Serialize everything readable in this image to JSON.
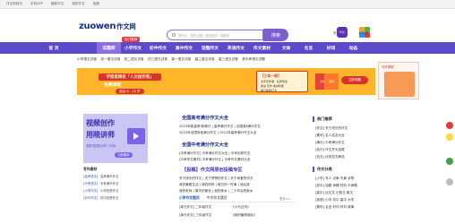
{
  "topbar": [
    "作文网首页",
    "手机APP",
    "最新作文",
    "我的作文",
    "投稿"
  ],
  "header": {
    "logo_word": "zuowen",
    "logo_cn": "作文网",
    "search_placeholder": "搜作文 / 搜作文题 / 搜关键词 / 搜素材",
    "search_button": "搜索",
    "app1_label": "官方APP",
    "app1_icon_text": "作文",
    "app2_label": "手机版",
    "hot_badge": "热门推荐"
  },
  "nav": [
    "首 页",
    "试题库",
    "小学作文",
    "初中作文",
    "高中作文",
    "话题作文",
    "英语作文",
    "作文素材",
    "文体",
    "名言",
    "好词",
    "动态"
  ],
  "nav_active": 1,
  "subnav": [
    "小学语文试卷",
    "初一语文试卷",
    "初二语文试卷",
    "初三语文试卷",
    "高一语文试卷",
    "高二语文试卷",
    "高三语文试卷",
    "其中考语文试题"
  ],
  "banner": {
    "headline": "学而思网校「人文创作课」",
    "sub": "免费领取",
    "age": "适合 6 - 13 岁",
    "mid_title": "【三年一轮】",
    "mid_lines": [
      "全年写作课 · 名师带读",
      "阅读·写作·素材积累",
      "每日练笔打卡"
    ],
    "book1": "文学",
    "book2": "写作",
    "button": "立即领取",
    "side_label": "写作课程"
  },
  "promo": {
    "line1": "视频创作",
    "line2": "用晓讲师",
    "tagline": "录屏/剪辑/分享一步搞",
    "cta": "立即使用"
  },
  "left_section": {
    "title": "写作素材",
    "rows": [
      [
        "[高考语文]",
        "高考满分作文"
      ],
      [
        "[中考语文]",
        "中考满分作文"
      ],
      [
        "[小学作文]",
        "小学优秀作文"
      ],
      [
        "[初中作文]",
        "初中优秀作文"
      ]
    ]
  },
  "center": {
    "title1": "全国高考满分作文大全",
    "lines1": [
      "2023年新高考Ⅰ卷满分 | 高考满分作文 | 全国卷Ⅱ满分作文",
      "2023年全国甲卷满分作文 | 2022年高考满分作文大全"
    ],
    "title2": "全国中考满分作文大全",
    "lines2": [
      "[中考满分作文] 中考满分作文大全 | 中考优秀作文",
      "[中考作文素材] 中考满分作文 | 中考作文素材大全"
    ],
    "title3": "【投稿】作文网原创投稿专区",
    "lines3": [
      "关于快乐的作文 | 关于梦想的作文 | 关于母爱的作文",
      "我的暑假生活 | 我的妈妈 | 难忘的一件事 | 读后感",
      "我的老师 | 春天的景色 | 我的家乡 | 二十年后的家乡"
    ],
    "tabs": [
      "小学作文题目",
      "中学作文题目",
      "高中作文题目"
    ],
    "more": "更多>>",
    "rows": [
      [
        "[单元作文] 二年级作文",
        "《小马过河》"
      ],
      [
        "[单元作文] 三年级作文",
        "《我的植物朋友》"
      ]
    ]
  },
  "right": {
    "title": "热门推荐",
    "items": [
      "[作文] 关于成长的作文",
      "[素材] 名人名言大全",
      "[满分] 中考满分作文",
      "[技巧] 作文开头结尾",
      "[范文] 优秀范文精选"
    ],
    "title2": "作文分类",
    "items2": [
      "[小学] 写人 记事 写景 状物",
      "[初中] 话题 命题 材料 半命题",
      "[高中] 议论文 记叙文 散文",
      "[英语] 小学 初中 高中 大学",
      "[素材] 名言 好词 好句 故事"
    ]
  },
  "colors": {
    "nav": "#5b4ac9",
    "accent": "#7b5fd1",
    "banner": "#ffb529",
    "promo": "#c9c6f4"
  }
}
